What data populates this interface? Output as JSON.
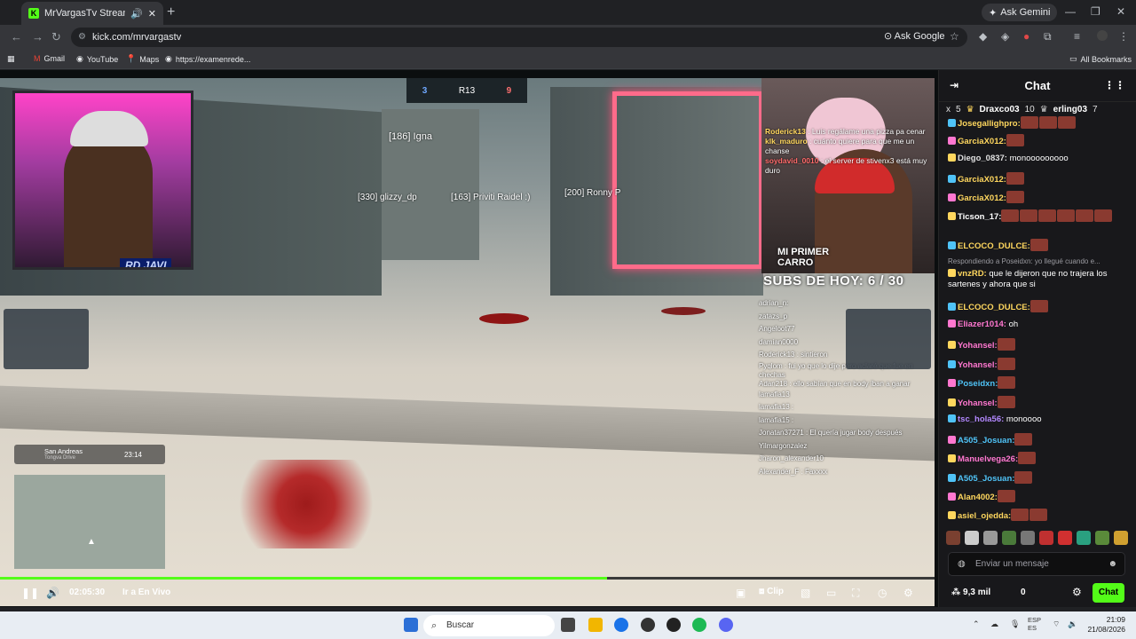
{
  "browser": {
    "tab_title": "MrVargasTv Stream - Watch",
    "tab_icon": "K",
    "ask_gemini": "Ask Gemini",
    "url": "kick.com/mrvargastv",
    "ask_google": "Ask Google",
    "bookmarks": [
      "Gmail",
      "YouTube",
      "Maps",
      "https://examenrede..."
    ],
    "all_bookmarks": "All Bookmarks"
  },
  "video": {
    "score_left": "3",
    "score_mid": "R13",
    "score_right": "9",
    "player_tags": [
      "[186] Igna",
      "[330] glizzy_dp",
      "[163] Priviti Raidel :)",
      "[200] Ronny P"
    ],
    "cam1_label": "RD JAVI",
    "cam2_label": "MI PRIMER CARRO",
    "overlay_chat": [
      {
        "user": "Roderick13",
        "text": " : Luis regálame una pizza pa cenar"
      },
      {
        "user": "klk_maduro",
        "text": " : cuánto quiere para que me un chanse"
      },
      {
        "user": "soydavid_0010",
        "text": " : el server de stivenx3 está muy duro"
      }
    ],
    "subs": "SUBS DE HOY: 6 / 30",
    "game_chat": [
      "adrian_n:",
      "zatazs_p",
      "Angeloot77",
      "damian0000",
      "Roderick13 : sintieron",
      "Pyqlom : fui yo que lo dije pero aclaré que fue en chechas",
      "Adan218 : ello sabían que en body iban a ganar",
      "lamafia13",
      "lamafia13 :",
      "lamafia15 :",
      "Jonatan37271 : El quería jugar body después",
      "Yilmargonzalez",
      "Jharon_alexander10",
      "Alexander_F : Faxxxx"
    ],
    "location": "San Andreas",
    "location_sub": "Tongva Drive",
    "location_time": "23:14",
    "timestamp": "02:05:30",
    "go_live": "Ir a En Vivo",
    "clip": "Clip",
    "progress": 0.65
  },
  "chat": {
    "title": "Chat",
    "leaders": [
      {
        "name": "x",
        "count": "5"
      },
      {
        "name": "Draxco03",
        "count": "10"
      },
      {
        "name": "erling03",
        "count": "7"
      }
    ],
    "messages": [
      {
        "user": "Josegallighpro:",
        "text": "",
        "color": "#ffd75e",
        "emotes": 3
      },
      {
        "user": "GarciaX012:",
        "text": "",
        "color": "#ffd75e",
        "emotes": 1
      },
      {
        "user": "Diego_0837:",
        "text": " monooooooooo",
        "color": "#e0e0e0",
        "emotes": 0
      },
      {
        "user": "GarciaX012:",
        "text": "",
        "color": "#ffd75e",
        "emotes": 1
      },
      {
        "user": "GarciaX012:",
        "text": "",
        "color": "#ffd75e",
        "emotes": 1
      },
      {
        "user": "Ticson_17:",
        "text": "",
        "color": "#ffffff",
        "emotes": 6
      },
      {
        "user": "ELCOCO_DULCE:",
        "text": "",
        "color": "#ffd75e",
        "emotes": 1
      },
      {
        "user": "Respondiendo a Poseidxn: yo llegué cuando e...",
        "text": "",
        "color": "#9a9aa0",
        "emotes": 0
      },
      {
        "user": "vnzRD:",
        "text": " que le dijeron que no trajera los sartenes y ahora que si",
        "color": "#ffd75e",
        "emotes": 0
      },
      {
        "user": "ELCOCO_DULCE:",
        "text": "",
        "color": "#ffd75e",
        "emotes": 1
      },
      {
        "user": "Eliazer1014:",
        "text": " oh",
        "color": "#ff77d0",
        "emotes": 0
      },
      {
        "user": "Yohansel:",
        "text": "",
        "color": "#ff77d0",
        "emotes": 1
      },
      {
        "user": "Yohansel:",
        "text": "",
        "color": "#ff77d0",
        "emotes": 1
      },
      {
        "user": "Poseidxn:",
        "text": "",
        "color": "#4fc3f7",
        "emotes": 1
      },
      {
        "user": "Yohansel:",
        "text": "",
        "color": "#ff77d0",
        "emotes": 1
      },
      {
        "user": "tsc_hola56:",
        "text": " monoooo",
        "color": "#b388ff",
        "emotes": 0
      },
      {
        "user": "A505_Josuan:",
        "text": "",
        "color": "#4fc3f7",
        "emotes": 1
      },
      {
        "user": "Manuelvega26:",
        "text": "",
        "color": "#ff77d0",
        "emotes": 1
      },
      {
        "user": "A505_Josuan:",
        "text": "",
        "color": "#4fc3f7",
        "emotes": 1
      },
      {
        "user": "Alan4002:",
        "text": "",
        "color": "#ffd75e",
        "emotes": 1
      },
      {
        "user": "asiel_ojedda:",
        "text": "",
        "color": "#ffd75e",
        "emotes": 2
      }
    ],
    "input_placeholder": "Enviar un mensaje",
    "viewers": "9,3 mil",
    "zero": "0",
    "chat_button": "Chat"
  },
  "taskbar": {
    "search": "Buscar",
    "lang_top": "ESP",
    "lang_bottom": "ES",
    "time": "21:09",
    "date": "21/08/2026"
  }
}
